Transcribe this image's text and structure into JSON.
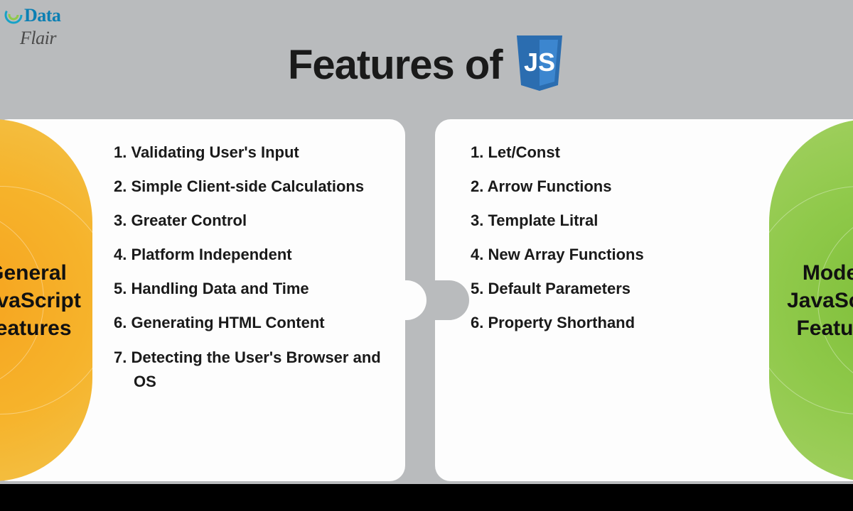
{
  "logo": {
    "brand_left": "Data",
    "brand_right": "Flair"
  },
  "title": "Features of",
  "js_badge": "JS",
  "left_panel": {
    "heading": "General\nJavaScript\nFeatures",
    "items": [
      "Validating User's Input",
      "Simple Client-side Calculations",
      "Greater Control",
      "Platform Independent",
      "Handling Data and Time",
      "Generating HTML Content",
      "Detecting the User's Browser and OS"
    ]
  },
  "right_panel": {
    "heading": "Modern\nJavaScript\nFeatures",
    "items": [
      "Let/Const",
      "Arrow Functions",
      "Template Litral",
      "New Array Functions",
      "Default Parameters",
      "Property Shorthand"
    ]
  },
  "watermark": {
    "brand_left": "Data",
    "brand_right": "Flair"
  }
}
